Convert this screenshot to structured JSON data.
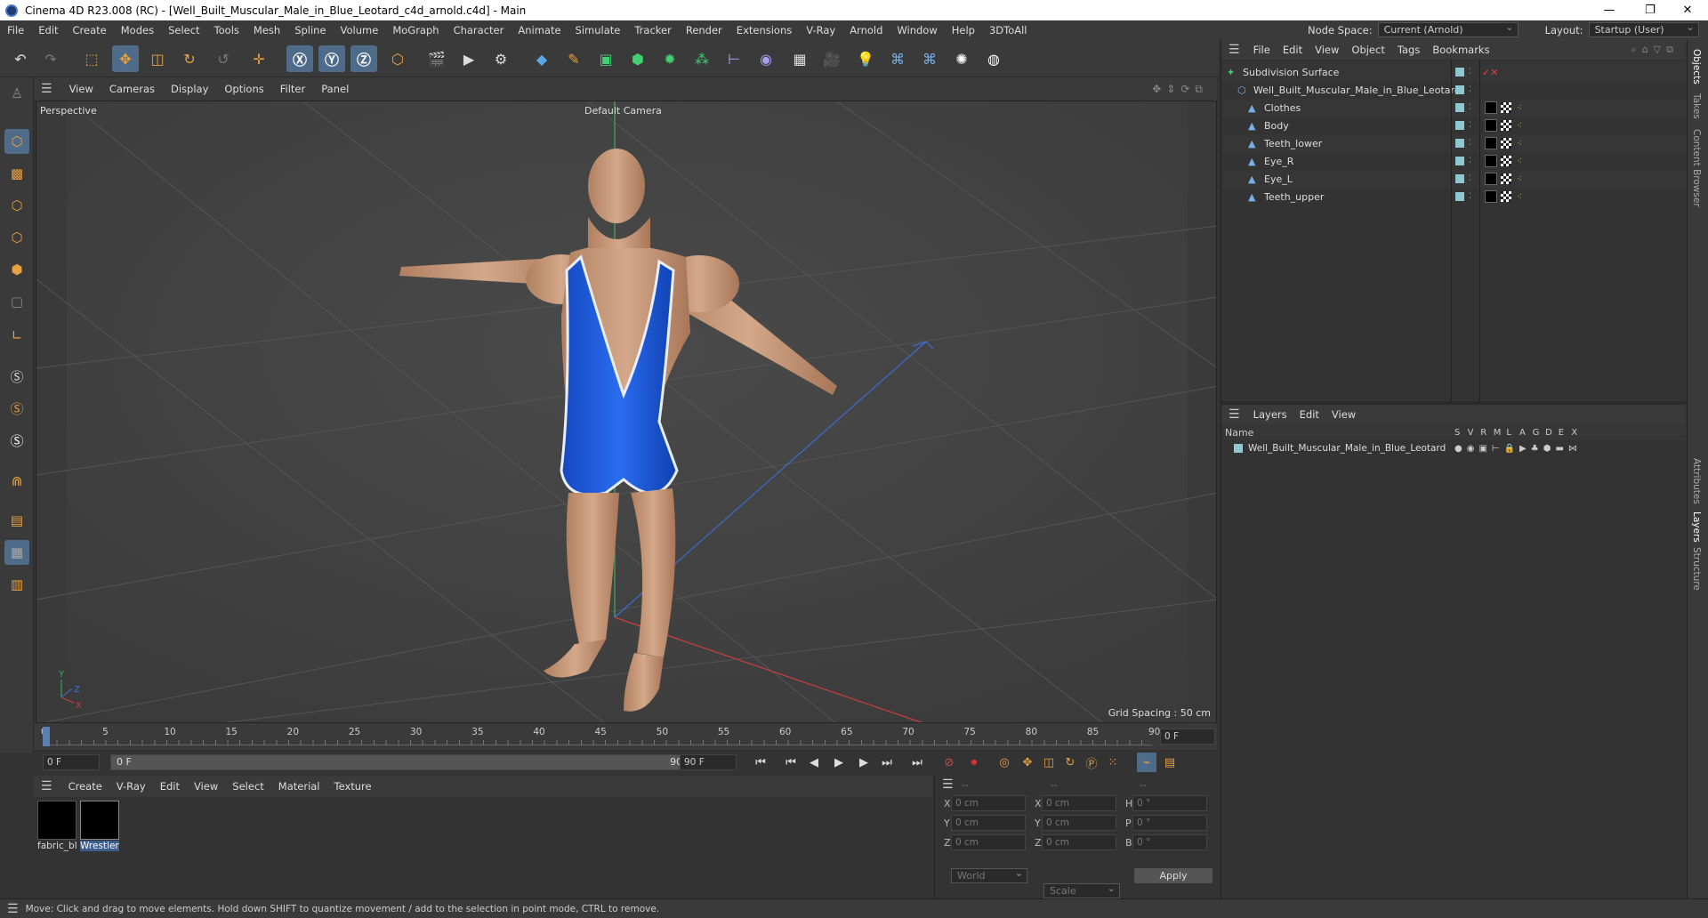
{
  "window": {
    "title": "Cinema 4D R23.008 (RC) - [Well_Built_Muscular_Male_in_Blue_Leotard_c4d_arnold.c4d] - Main",
    "minimize": "—",
    "maximize": "❐",
    "close": "✕"
  },
  "menubar": {
    "items": [
      "File",
      "Edit",
      "Create",
      "Modes",
      "Select",
      "Tools",
      "Mesh",
      "Spline",
      "Volume",
      "MoGraph",
      "Character",
      "Animate",
      "Simulate",
      "Tracker",
      "Render",
      "Extensions",
      "V-Ray",
      "Arnold",
      "Window",
      "Help",
      "3DToAll"
    ],
    "node_space_label": "Node Space:",
    "node_space_value": "Current (Arnold)",
    "layout_label": "Layout:",
    "layout_value": "Startup (User)"
  },
  "viewport": {
    "menu": [
      "View",
      "Cameras",
      "Display",
      "Options",
      "Filter",
      "Panel"
    ],
    "view_name": "Perspective",
    "camera": "Default Camera",
    "grid_spacing": "Grid Spacing : 50 cm",
    "axis_y": "Y",
    "axis_z": "Z",
    "axis_x": "X"
  },
  "timeline": {
    "ticks": [
      "0",
      "5",
      "10",
      "15",
      "20",
      "25",
      "30",
      "35",
      "40",
      "45",
      "50",
      "55",
      "60",
      "65",
      "70",
      "75",
      "80",
      "85",
      "90"
    ],
    "current_frame": "0 F",
    "start_field": "0 F",
    "range_start": "0 F",
    "range_end": "90 F",
    "end_field": "90 F"
  },
  "materials": {
    "menu": [
      "Create",
      "V-Ray",
      "Edit",
      "View",
      "Select",
      "Material",
      "Texture"
    ],
    "items": [
      {
        "name": "fabric_bl"
      },
      {
        "name": "Wrestler"
      }
    ]
  },
  "coords": {
    "header": [
      "--",
      "--",
      "--"
    ],
    "rows": [
      {
        "a": "X",
        "av": "0 cm",
        "b": "X",
        "bv": "0 cm",
        "c": "H",
        "cv": "0 °"
      },
      {
        "a": "Y",
        "av": "0 cm",
        "b": "Y",
        "bv": "0 cm",
        "c": "P",
        "cv": "0 °"
      },
      {
        "a": "Z",
        "av": "0 cm",
        "b": "Z",
        "bv": "0 cm",
        "c": "B",
        "cv": "0 °"
      }
    ],
    "mode1": "World",
    "mode2": "Scale",
    "apply": "Apply"
  },
  "objects": {
    "menu": [
      "File",
      "Edit",
      "View",
      "Object",
      "Tags",
      "Bookmarks"
    ],
    "tree": [
      {
        "name": "Subdivision Surface",
        "level": 0
      },
      {
        "name": "Well_Built_Muscular_Male_in_Blue_Leotard",
        "level": 1
      },
      {
        "name": "Clothes",
        "level": 2
      },
      {
        "name": "Body",
        "level": 2
      },
      {
        "name": "Teeth_lower",
        "level": 2
      },
      {
        "name": "Eye_R",
        "level": 2
      },
      {
        "name": "Eye_L",
        "level": 2
      },
      {
        "name": "Teeth_upper",
        "level": 2
      }
    ]
  },
  "layers": {
    "menu": [
      "Layers",
      "Edit",
      "View"
    ],
    "header_name": "Name",
    "columns": [
      "S",
      "V",
      "R",
      "M",
      "L",
      "A",
      "G",
      "D",
      "E",
      "X"
    ],
    "items": [
      {
        "name": "Well_Built_Muscular_Male_in_Blue_Leotard"
      }
    ]
  },
  "sidetabs": [
    "Objects",
    "Takes",
    "Content Browser",
    "Attributes",
    "Layers",
    "Structure"
  ],
  "status": "Move: Click and drag to move elements. Hold down SHIFT to quantize movement / add to the selection in point mode, CTRL to remove.",
  "colors": {
    "accent": "#4f6b8a",
    "x_axis": "#c84040",
    "y_axis": "#40b060",
    "z_axis": "#3d6fd6",
    "leotard": "#1d5fe0",
    "skin": "#c79a7a"
  }
}
